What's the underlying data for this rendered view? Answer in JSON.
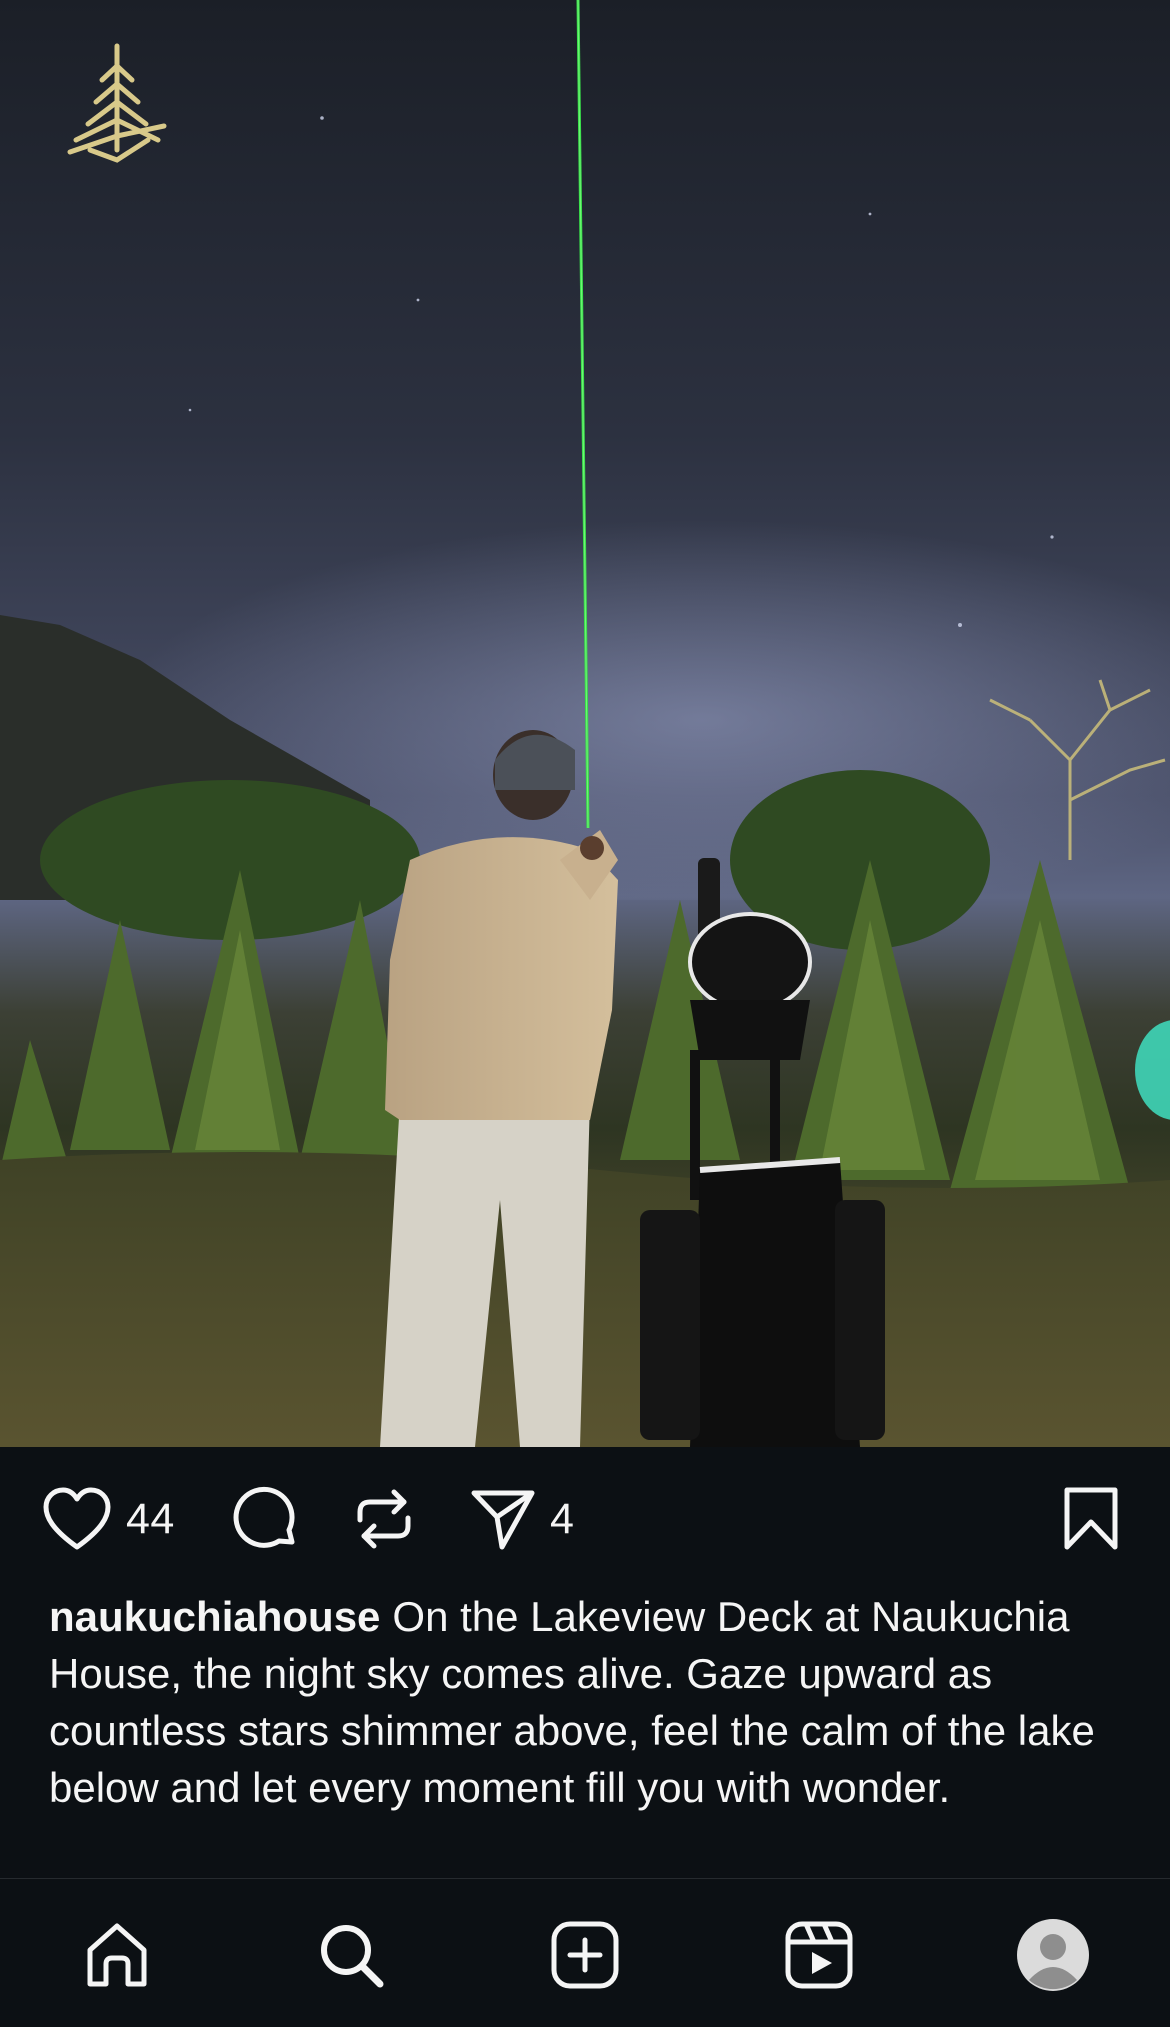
{
  "post": {
    "image_alt": "Man pointing a green laser into the night sky beside a telescope on a lakeview deck",
    "logo_icon": "pine-cone-logo-icon",
    "likes": "44",
    "shares": "4",
    "username": "naukuchiahouse",
    "caption": "On the Lakeview Deck at Naukuchia House, the night sky comes alive. Gaze upward as countless stars shimmer above, feel the calm of the lake below and let every moment fill you with wonder."
  },
  "actions": {
    "like_icon": "heart-icon",
    "comment_icon": "comment-icon",
    "repost_icon": "repost-icon",
    "share_icon": "send-icon",
    "save_icon": "bookmark-icon"
  },
  "nav": {
    "items": [
      {
        "icon": "home-icon"
      },
      {
        "icon": "search-icon"
      },
      {
        "icon": "create-icon"
      },
      {
        "icon": "reels-icon"
      },
      {
        "icon": "profile-avatar"
      }
    ]
  },
  "colors": {
    "background": "#0c1014",
    "text": "#f5f5f5",
    "laser": "#39e04a",
    "logo": "#d8c98a"
  }
}
